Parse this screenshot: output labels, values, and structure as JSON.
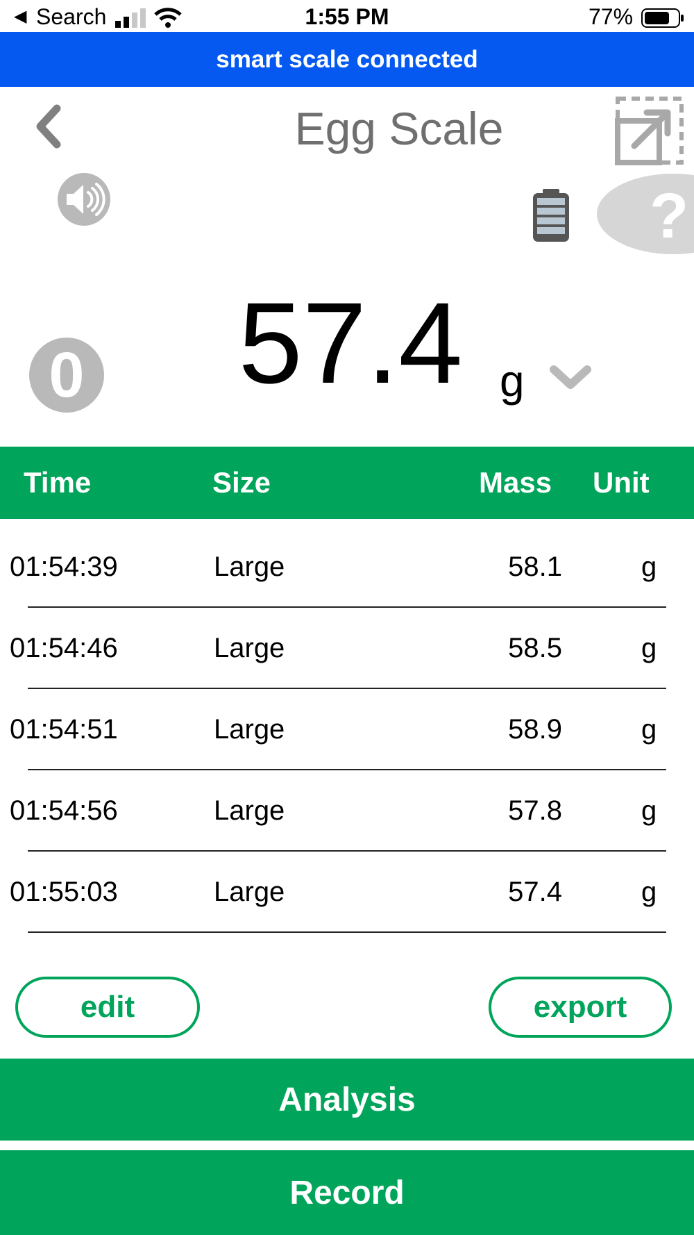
{
  "status_bar": {
    "back_glyph": "◀",
    "back_label": "Search",
    "time": "1:55 PM",
    "battery_percent": "77%",
    "battery_level": 0.77,
    "signal_bars": 2
  },
  "banner": {
    "text": "smart scale connected"
  },
  "header": {
    "title": "Egg Scale",
    "back_icon": "chevron-left-icon",
    "expand_icon": "expand-icon"
  },
  "controls": {
    "speaker_icon": "speaker-icon",
    "battery_icon": "battery-icon",
    "help_glyph": "?"
  },
  "reading": {
    "zero_label": "0",
    "value": "57.4",
    "unit": "g"
  },
  "table": {
    "headers": {
      "time": "Time",
      "size": "Size",
      "mass": "Mass",
      "unit": "Unit"
    },
    "rows": [
      {
        "time": "01:54:39",
        "size": "Large",
        "mass": "58.1",
        "unit": "g"
      },
      {
        "time": "01:54:46",
        "size": "Large",
        "mass": "58.5",
        "unit": "g"
      },
      {
        "time": "01:54:51",
        "size": "Large",
        "mass": "58.9",
        "unit": "g"
      },
      {
        "time": "01:54:56",
        "size": "Large",
        "mass": "57.8",
        "unit": "g"
      },
      {
        "time": "01:55:03",
        "size": "Large",
        "mass": "57.4",
        "unit": "g"
      }
    ]
  },
  "actions": {
    "edit_label": "edit",
    "export_label": "export",
    "analysis_label": "Analysis",
    "record_label": "Record"
  },
  "colors": {
    "banner": "#0559f0",
    "accent_green": "#00a45a",
    "icon_gray": "#b9b9b9",
    "title_gray": "#6f6f6f"
  }
}
